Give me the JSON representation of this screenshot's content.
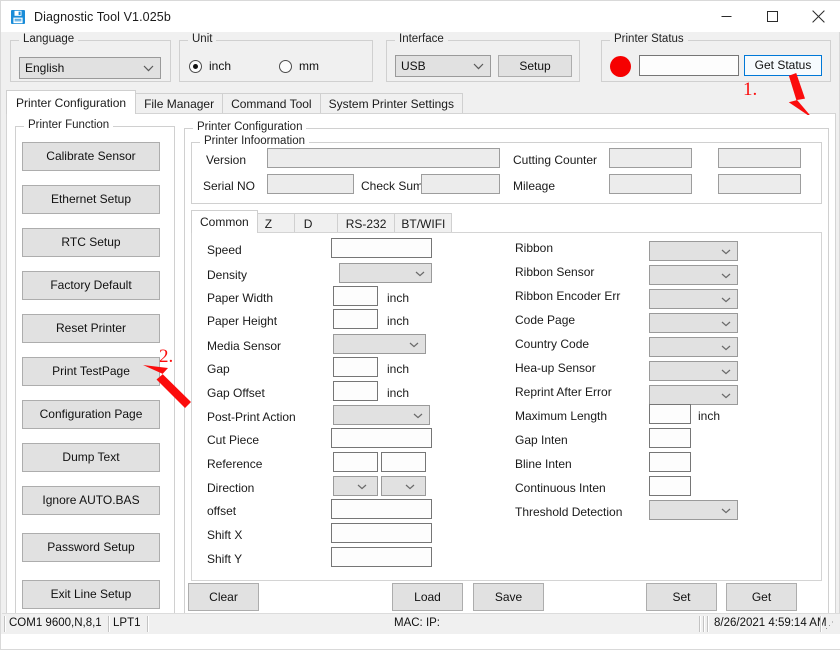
{
  "window": {
    "title": "Diagnostic Tool V1.025b",
    "icon": "floppy-disk-icon",
    "minimize": "–",
    "maximize": "□",
    "close": "✕"
  },
  "top": {
    "language": {
      "legend": "Language",
      "value": "English"
    },
    "unit": {
      "legend": "Unit",
      "options": [
        {
          "label": "inch",
          "checked": true
        },
        {
          "label": "mm",
          "checked": false
        }
      ]
    },
    "interface": {
      "legend": "Interface",
      "value": "USB",
      "setup_label": "Setup"
    },
    "printer_status": {
      "legend": "Printer  Status",
      "led_color": "#f60000",
      "value": "",
      "get_status_label": "Get Status"
    }
  },
  "main_tabs": [
    {
      "label": "Printer Configuration",
      "active": true
    },
    {
      "label": "File Manager",
      "active": false
    },
    {
      "label": "Command Tool",
      "active": false
    },
    {
      "label": "System Printer Settings",
      "active": false
    }
  ],
  "printer_function": {
    "legend": "Printer  Function",
    "buttons": [
      "Calibrate Sensor",
      "Ethernet Setup",
      "RTC Setup",
      "Factory Default",
      "Reset Printer",
      "Print TestPage",
      "Configuration Page",
      "Dump Text",
      "Ignore AUTO.BAS",
      "Password Setup",
      "Exit Line Setup"
    ]
  },
  "printer_configuration": {
    "legend": "Printer Configuration",
    "information": {
      "legend": "Printer Infoormation",
      "version_label": "Version",
      "version_value": "",
      "serial_label": "Serial NO",
      "serial_value": "",
      "checksum_label": "Check Sum",
      "checksum_value": "",
      "cutting_counter_label": "Cutting Counter",
      "cutting_counter_value": "",
      "cutting_counter_value2": "",
      "mileage_label": "Mileage",
      "mileage_value": "",
      "mileage_value2": ""
    },
    "sub_tabs": [
      {
        "label": "Common",
        "active": true
      },
      {
        "label": "Z",
        "active": false
      },
      {
        "label": "D",
        "active": false
      },
      {
        "label": "RS-232",
        "active": false
      },
      {
        "label": "BT/WIFI",
        "active": false
      }
    ],
    "common_left": [
      {
        "label": "Speed",
        "type": "text",
        "value": ""
      },
      {
        "label": "Density",
        "type": "combo",
        "value": ""
      },
      {
        "label": "Paper Width",
        "type": "text-unit",
        "value": "",
        "unit": "inch"
      },
      {
        "label": "Paper Height",
        "type": "text-unit",
        "value": "",
        "unit": "inch"
      },
      {
        "label": "Media Sensor",
        "type": "combo",
        "value": ""
      },
      {
        "label": "Gap",
        "type": "text-unit",
        "value": "",
        "unit": "inch"
      },
      {
        "label": "Gap Offset",
        "type": "text-unit",
        "value": "",
        "unit": "inch"
      },
      {
        "label": "Post-Print  Action",
        "type": "combo",
        "value": ""
      },
      {
        "label": "Cut  Piece",
        "type": "text",
        "value": ""
      },
      {
        "label": "Reference",
        "type": "text-pair",
        "value": "",
        "value2": ""
      },
      {
        "label": "Direction",
        "type": "combo-pair",
        "value": "",
        "value2": ""
      },
      {
        "label": "offset",
        "type": "text",
        "value": ""
      },
      {
        "label": "Shift X",
        "type": "text",
        "value": ""
      },
      {
        "label": "Shift Y",
        "type": "text",
        "value": ""
      }
    ],
    "common_right": [
      {
        "label": "Ribbon",
        "type": "combo",
        "value": ""
      },
      {
        "label": "Ribbon  Sensor",
        "type": "combo",
        "value": ""
      },
      {
        "label": "Ribbon Encoder Err",
        "type": "combo",
        "value": ""
      },
      {
        "label": "Code Page",
        "type": "combo",
        "value": ""
      },
      {
        "label": "Country Code",
        "type": "combo",
        "value": ""
      },
      {
        "label": "Hea-up  Sensor",
        "type": "combo",
        "value": ""
      },
      {
        "label": "Reprint After  Error",
        "type": "combo",
        "value": ""
      },
      {
        "label": "Maximum Length",
        "type": "text-unit",
        "value": "",
        "unit": "inch"
      },
      {
        "label": "Gap Inten",
        "type": "text-short",
        "value": ""
      },
      {
        "label": "Bline  Inten",
        "type": "text-short",
        "value": ""
      },
      {
        "label": "Continuous  Inten",
        "type": "text-short",
        "value": ""
      },
      {
        "label": "Threshold  Detection",
        "type": "combo",
        "value": ""
      }
    ],
    "action_buttons": [
      "Clear",
      "Load",
      "Save",
      "Set",
      "Get"
    ]
  },
  "statusbar": {
    "com": "COM1 9600,N,8,1",
    "lpt": "LPT1",
    "mac_ip": "MAC: IP:",
    "datetime": "8/26/2021 4:59:14 AM"
  },
  "annotations": [
    {
      "number": "1.",
      "color": "#fb0c0c",
      "target": "get-status-button"
    },
    {
      "number": "2.",
      "color": "#fb0c0c",
      "target": "print-testpage-button"
    }
  ]
}
